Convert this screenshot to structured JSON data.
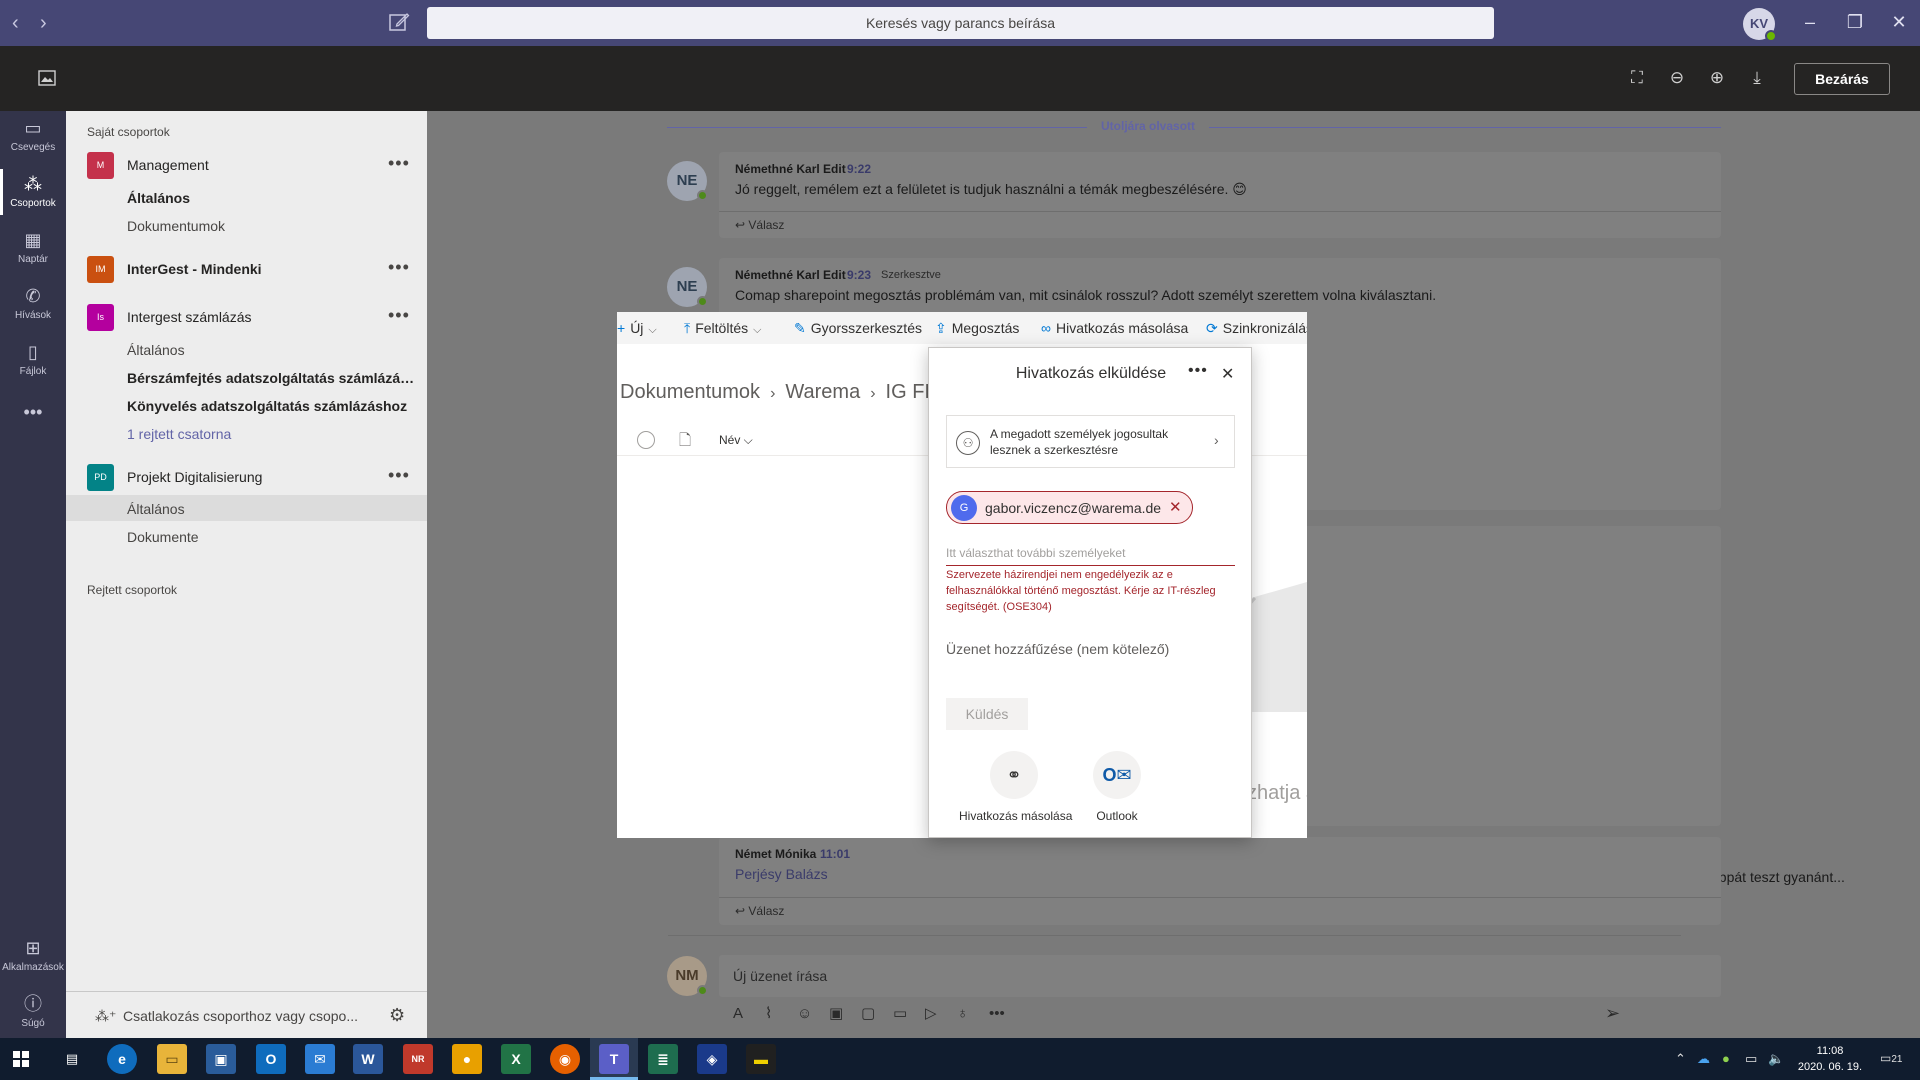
{
  "titlebar": {
    "search_placeholder": "Keresés vagy parancs beírása",
    "avatar_initials": "KV"
  },
  "viewer": {
    "close_label": "Bezárás"
  },
  "rail": {
    "items": [
      {
        "label": "Csevegés",
        "icon": "chat-icon"
      },
      {
        "label": "Csoportok",
        "icon": "teams-icon"
      },
      {
        "label": "Naptár",
        "icon": "calendar-icon"
      },
      {
        "label": "Hívások",
        "icon": "phone-icon"
      },
      {
        "label": "Fájlok",
        "icon": "files-icon"
      },
      {
        "label": "Alkalmazások",
        "icon": "apps-icon"
      },
      {
        "label": "Súgó",
        "icon": "help-icon"
      }
    ]
  },
  "teams_panel": {
    "my_teams_label": "Saját csoportok",
    "hidden_teams_label": "Rejtett csoportok",
    "teams": [
      {
        "initials": "M",
        "name": "Management",
        "color": "#c4314b",
        "channels": [
          "Általános",
          "Dokumentumok"
        ]
      },
      {
        "initials": "IM",
        "name": "InterGest - Mindenki",
        "color": "#ca5010",
        "channels": []
      },
      {
        "initials": "Is",
        "name": "Intergest számlázás",
        "color": "#b4009e",
        "channels": [
          "Általános",
          "Bérszámfejtés adatszolgáltatás számlázás...",
          "Könyvelés adatszolgáltatás számlázáshoz",
          "1 rejtett csatorna"
        ]
      },
      {
        "initials": "PD",
        "name": "Projekt Digitalisierung",
        "color": "#038387",
        "channels": [
          "Általános",
          "Dokumente"
        ]
      }
    ],
    "join_label": "Csatlakozás csoporthoz vagy csopo..."
  },
  "chat": {
    "last_read_label": "Utoljára olvasott",
    "messages": [
      {
        "initials": "NE",
        "author": "Némethné Karl Edit",
        "time": "9:22",
        "edited": "",
        "text": "Jó reggelt, remélem ezt a felületet is tudjuk használni a témák megbeszélésére. 😊",
        "reply": "Válasz"
      },
      {
        "initials": "NE",
        "author": "Némethné Karl Edit",
        "time": "9:23",
        "edited": "Szerkesztve",
        "text": "Comap sharepoint megosztás problémám van, mit csinálok rosszul? Adott személyt szerettem volna kiválasztani.",
        "reply": ""
      },
      {
        "initials": "NM",
        "author": "Német Mónika",
        "time": "11:01",
        "edited": "",
        "text": "Perjésy Balázs",
        "reply": "Válasz"
      }
    ],
    "partial_text": "mailcimmel egy mappát teszt gyanánt...",
    "compose_placeholder": "Új üzenet írása"
  },
  "sharepoint": {
    "commands": [
      {
        "label": "Új",
        "icon": "plus-icon",
        "has_dropdown": true
      },
      {
        "label": "Feltöltés",
        "icon": "upload-icon",
        "has_dropdown": true
      },
      {
        "label": "Gyorsszerkesztés",
        "icon": "pencil-icon",
        "has_dropdown": false
      },
      {
        "label": "Megosztás",
        "icon": "share-icon",
        "has_dropdown": false
      },
      {
        "label": "Hivatkozás másolása",
        "icon": "link-icon",
        "has_dropdown": false
      },
      {
        "label": "Szinkronizálás",
        "icon": "sync-icon",
        "has_dropdown": false
      }
    ],
    "breadcrumb": [
      "Dokumentumok",
      "Warema",
      "IG FI"
    ],
    "column_name": "Név",
    "empty_text": "zhatja a"
  },
  "share_dialog": {
    "title": "Hivatkozás elküldése",
    "permission_text": "A megadott személyek jogosultak lesznek a szerkesztésre",
    "recipient": {
      "initial": "G",
      "email": "gabor.viczencz@warema.de"
    },
    "people_placeholder": "Itt választhat további személyeket",
    "error": "Szervezete házirendjei nem engedélyezik az e felhasználókkal történő megosztást. Kérje az IT-részleg segítségét. (OSE304)",
    "message_placeholder": "Üzenet hozzáfűzése (nem kötelező)",
    "send_label": "Küldés",
    "options": [
      {
        "label": "Hivatkozás másolása",
        "icon": "link-icon"
      },
      {
        "label": "Outlook",
        "icon": "outlook-icon"
      }
    ]
  },
  "taskbar": {
    "time": "11:08",
    "date": "2020. 06. 19.",
    "notifications": "21"
  }
}
